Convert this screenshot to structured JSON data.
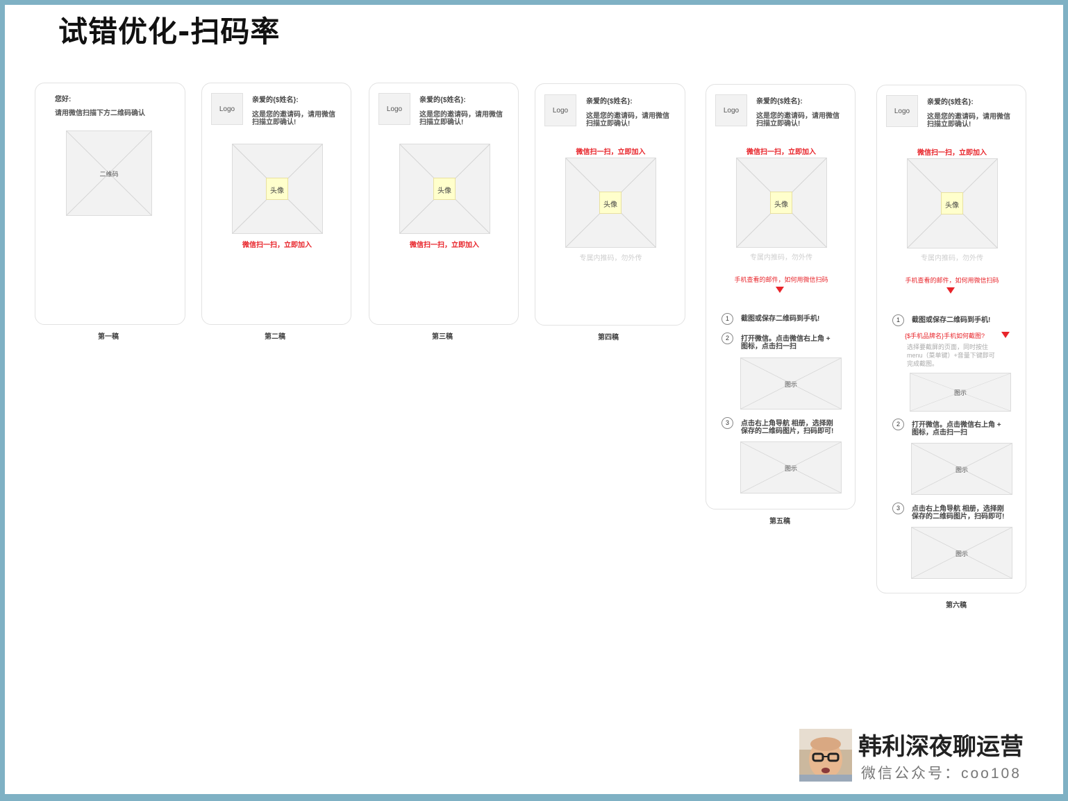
{
  "title": "试错优化-扫码率",
  "common": {
    "logo": "Logo",
    "dear": "亲爱的{$姓名}:",
    "invite": [
      "这是您的邀请码，请用微信",
      "扫描立即确认!"
    ],
    "avatar": "头像",
    "scan_join": "微信扫一扫，立即加入",
    "exclusive": "专属内推码，勿外传",
    "mail_howto": "手机查看的邮件，如何用微信扫码",
    "illustration": "图示",
    "step1": "截图或保存二维码到手机!",
    "step2": [
      "打开微信。点击微信右上角 +",
      "图标，点击扫一扫"
    ],
    "step3": [
      "点击右上角导航 相册，选择刚",
      "保存的二维码图片，扫码即可!"
    ],
    "brand_howto": "{$手机品牌名}手机如何截图?",
    "brand_hint": [
      "选择要截屏的页面，同时按住",
      "menu（菜单键）+音量下键即可",
      "完成截图。"
    ]
  },
  "draft1": {
    "greeting": "您好:",
    "instruction": "请用微信扫描下方二维码确认",
    "qr": "二维码"
  },
  "captions": [
    "第一稿",
    "第二稿",
    "第三稿",
    "第四稿",
    "第五稿",
    "第六稿"
  ],
  "step_numbers": [
    "1",
    "2",
    "3"
  ],
  "footer": {
    "name": "韩利深夜聊运营",
    "subtitle": "微信公众号：coo108"
  },
  "colors": {
    "accent_red": "#e8242a",
    "frame": "#7fb1c4",
    "avatar_fill": "#ffffcc"
  }
}
